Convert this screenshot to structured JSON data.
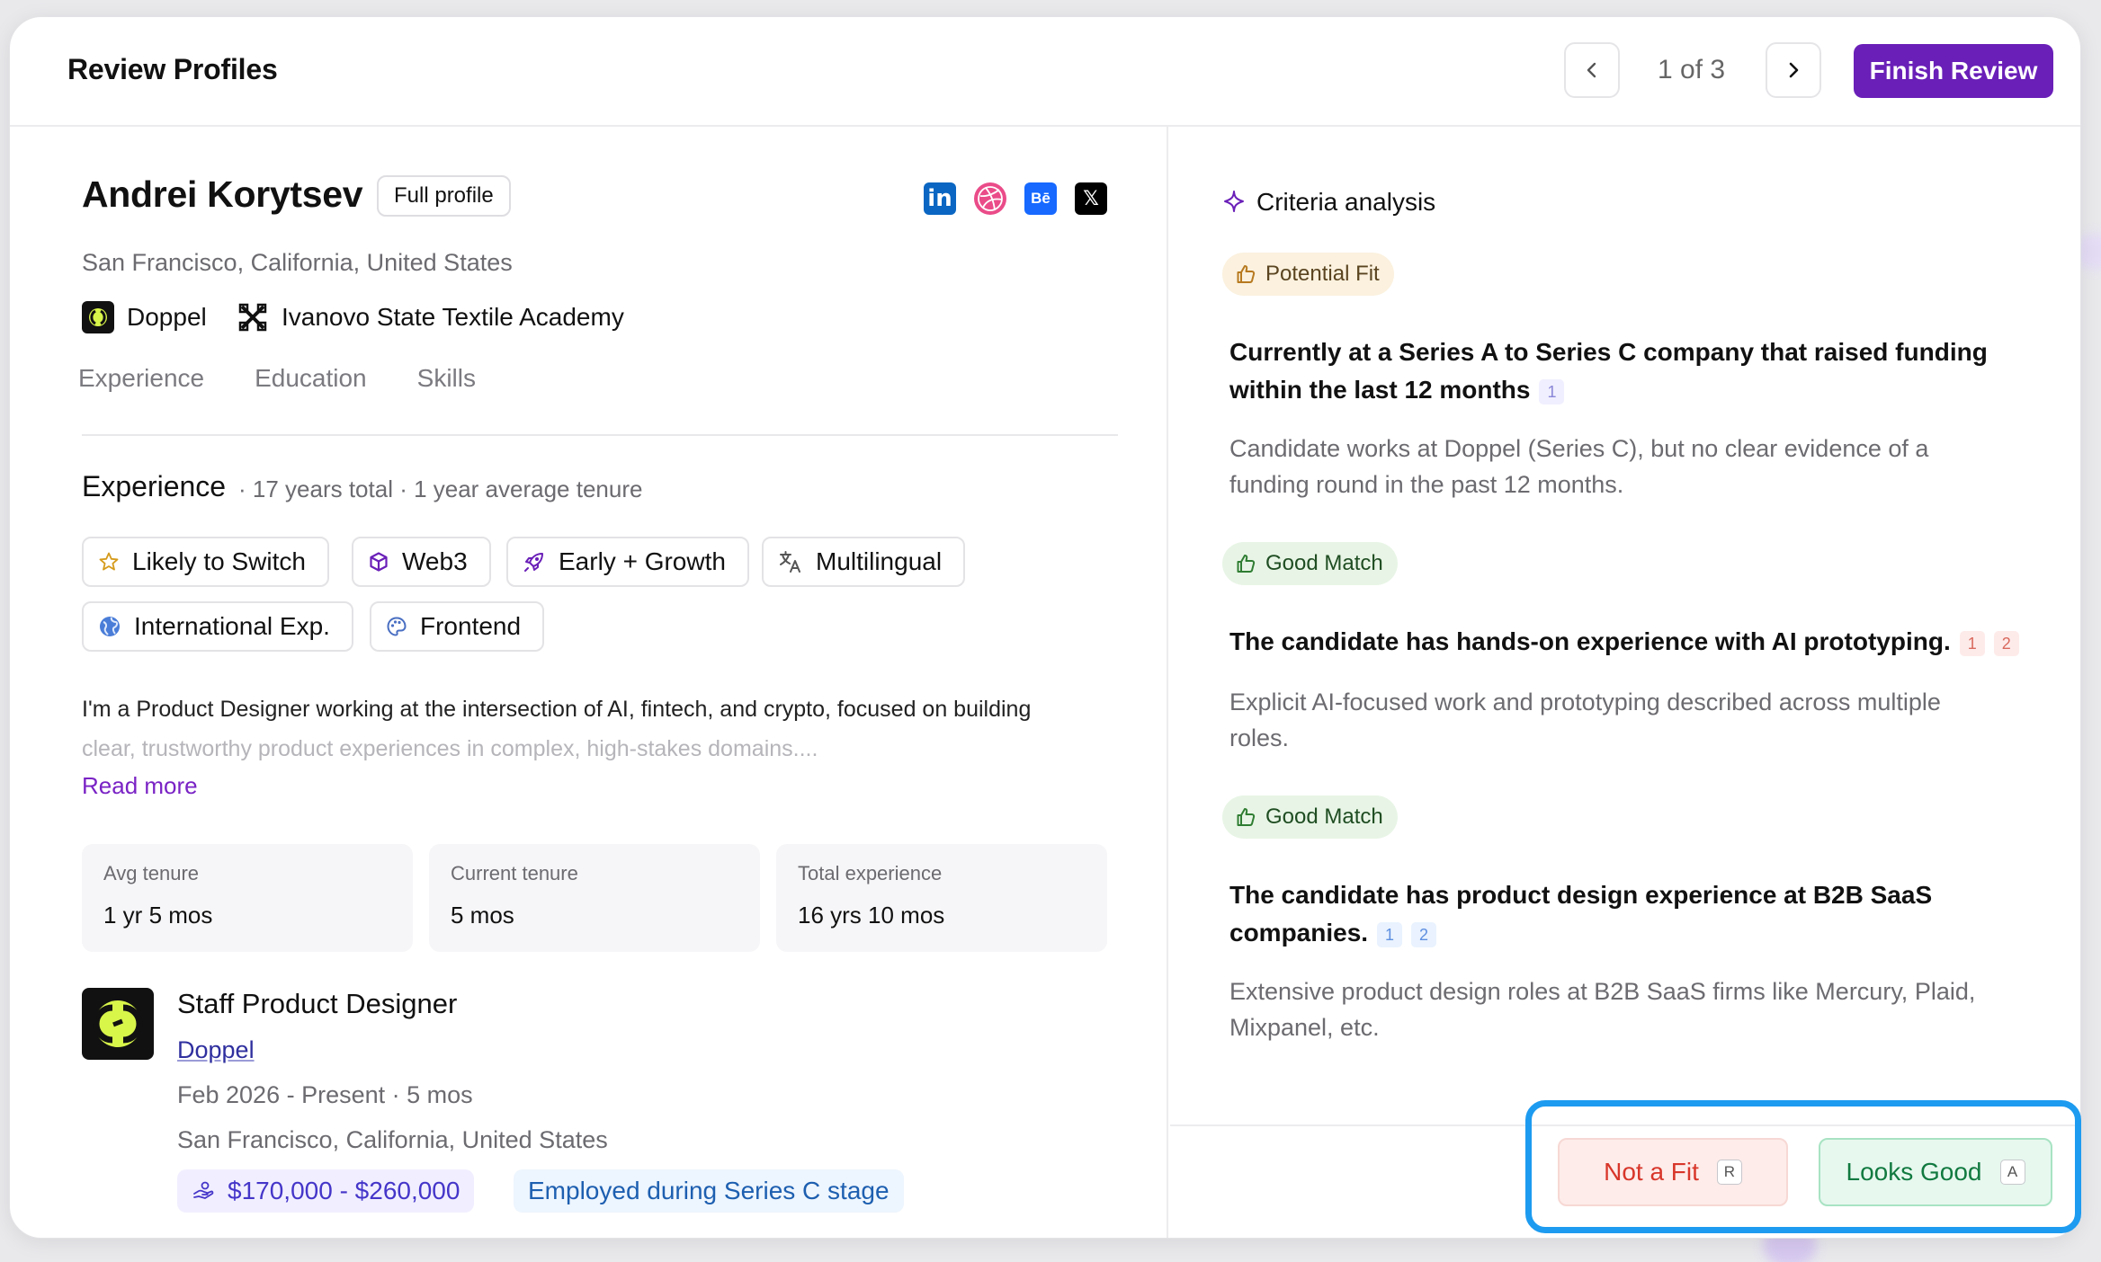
{
  "header": {
    "title": "Review Profiles",
    "pager": "1 of 3",
    "finish_label": "Finish Review"
  },
  "profile": {
    "name": "Andrei Korytsev",
    "full_profile_label": "Full profile",
    "location": "San Francisco, California, United States",
    "company": "Doppel",
    "school": "Ivanovo State Textile Academy",
    "socials": {
      "linkedin": "in",
      "behance": "Bē",
      "x": "𝕏"
    }
  },
  "tabs": [
    "Experience",
    "Education",
    "Skills"
  ],
  "experience": {
    "heading": "Experience",
    "meta": "· 17 years total · 1 year average tenure",
    "tags": [
      "Likely to Switch",
      "Web3",
      "Early + Growth",
      "Multilingual",
      "International Exp.",
      "Frontend"
    ],
    "bio_line1": "I'm a Product Designer working at the intersection of AI, fintech, and crypto, focused on building",
    "bio_line2": "clear, trustworthy product experiences in complex, high-stakes domains....",
    "read_more": "Read more",
    "stats": [
      {
        "label": "Avg tenure",
        "value": "1 yr 5 mos"
      },
      {
        "label": "Current tenure",
        "value": "5 mos"
      },
      {
        "label": "Total experience",
        "value": "16 yrs 10 mos"
      }
    ]
  },
  "job": {
    "title": "Staff Product Designer",
    "company": "Doppel",
    "dates": "Feb 2026 - Present · 5 mos",
    "location": "San Francisco, California, United States",
    "salary": "$170,000 - $260,000",
    "stage": "Employed during Series C stage"
  },
  "criteria": {
    "title": "Criteria analysis",
    "items": [
      {
        "badge": "Potential Fit",
        "text_line1": "Currently at a Series A to Series C company that raised funding",
        "text_line2": "within the last 12 months",
        "refs": [
          "1"
        ],
        "desc_line1": "Candidate works at Doppel (Series C), but no clear evidence of a",
        "desc_line2": "funding round in the past 12 months."
      },
      {
        "badge": "Good Match",
        "text_line1": "The candidate has hands-on experience with AI prototyping.",
        "refs": [
          "1",
          "2"
        ],
        "desc_line1": "Explicit AI-focused work and prototyping described across multiple",
        "desc_line2": "roles."
      },
      {
        "badge": "Good Match",
        "text_line1": "The candidate has product design experience at B2B SaaS",
        "text_line2": "companies.",
        "refs": [
          "1",
          "2"
        ],
        "desc_line1": "Extensive product design roles at B2B SaaS firms like Mercury, Plaid,",
        "desc_line2": "Mixpanel, etc."
      }
    ]
  },
  "actions": {
    "not_fit": "Not a Fit",
    "not_fit_key": "R",
    "looks_good": "Looks Good",
    "looks_good_key": "A"
  },
  "colors": {
    "accent": "#6a1fb8",
    "highlight": "#1d9bf0",
    "potential": "#b7791f",
    "good": "#2f7d32"
  }
}
